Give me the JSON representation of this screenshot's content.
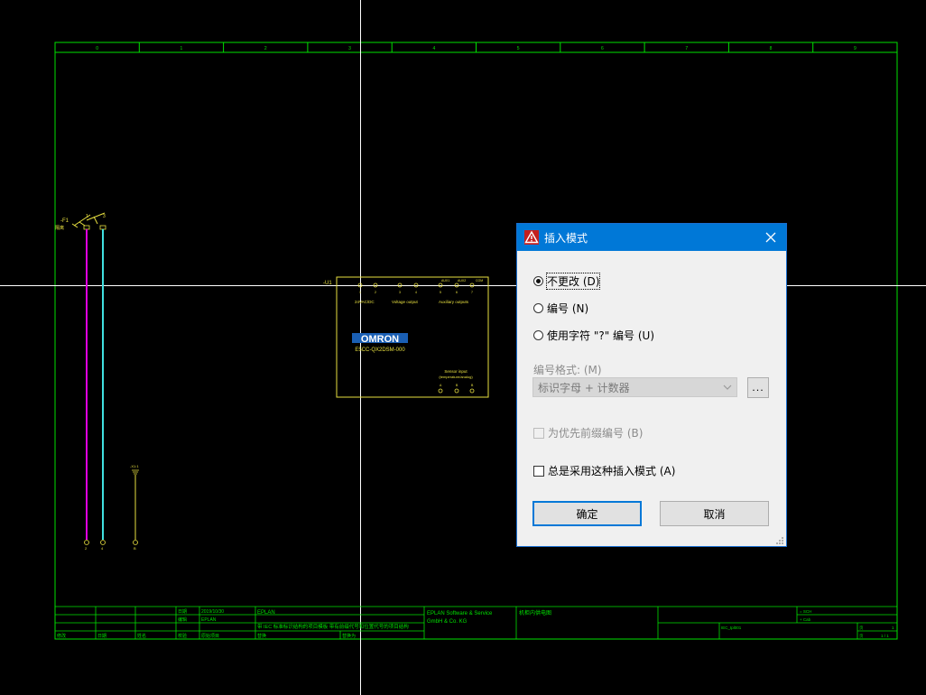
{
  "schematic": {
    "column_numbers": [
      "0",
      "1",
      "2",
      "3",
      "4",
      "5",
      "6",
      "7",
      "8",
      "9"
    ],
    "fuse": {
      "tag": "-F1",
      "sub": "隔离",
      "pin_left": "1",
      "pin_right": "3"
    },
    "fuse_bottom_pins": [
      "2",
      "4"
    ],
    "device": {
      "tag": "-U1",
      "brand": "OMRON",
      "model": "E5CC-QX2DSM-000",
      "label_supply": "24VAC/DC",
      "label_voltage_output": "Voltage output",
      "label_aux_outputs": "Auxiliary outputs",
      "label_sensor_input": "Sensor input",
      "label_sensor_input_sub": "(temperature/analog)",
      "top_pins": [
        "1",
        "2",
        "3",
        "4",
        "5",
        "6",
        "7",
        "8"
      ],
      "aux_pins": [
        "AUX1",
        "AUX2",
        "COM"
      ],
      "bottom_pins": [
        "A",
        "B",
        "B"
      ]
    },
    "terminal": {
      "tag": "-X1:1",
      "bottom_pin": "B"
    },
    "title_block": {
      "date_label": "日期",
      "date_value": "2019/10/30",
      "editor_label": "编辑",
      "editor_value": "EPLAN",
      "check_label": "校验",
      "check_value": "原始项目",
      "company_short": "EPLAN",
      "description": "带 IEC 标准标识结构的项目模板 带有前缀代号和位置代号的项目结构",
      "company_name_1": "EPLAN Software & Service",
      "company_name_2": "GmbH & Co. KG",
      "drawing_title": "机柜内供电图",
      "row1_labels": [
        "修改",
        "日期",
        "姓名"
      ],
      "row2_label": "替换",
      "row2_label_b": "替换为",
      "plant_label": "= SCH",
      "location_label": "+ Cab",
      "doc_code": "IEC_tpl001",
      "page_label": "页",
      "page_value": "1",
      "sheet_label": "页",
      "sheet_value": "1 / 1"
    }
  },
  "dialog": {
    "title": "插入模式",
    "options": [
      {
        "label": "不更改 (D)",
        "selected": true
      },
      {
        "label": "编号 (N)",
        "selected": false
      },
      {
        "label": "使用字符 \"?\" 编号 (U)",
        "selected": false
      }
    ],
    "format_label": "编号格式: (M)",
    "format_value": "标识字母 + 计数器",
    "dots_label": "...",
    "prefix_checkbox_label": "为优先前缀编号 (B)",
    "always_checkbox_label": "总是采用这种插入模式 (A)",
    "ok_label": "确定",
    "cancel_label": "取消"
  },
  "colors": {
    "border_green": "#00e000",
    "device_yellow": "#e8e040",
    "wire_magenta": "#e000e0",
    "wire_cyan": "#40e0e0",
    "wire_yellow": "#e8e040",
    "title_accent": "#0078d7"
  }
}
